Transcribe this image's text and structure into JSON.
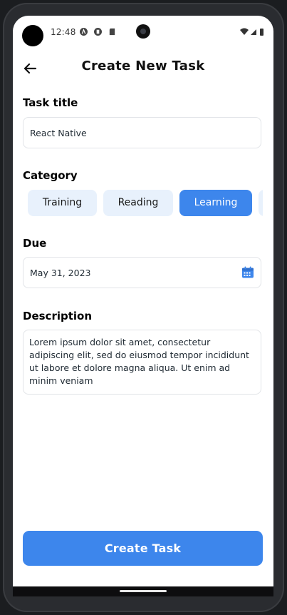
{
  "status_bar": {
    "time": "12:48"
  },
  "header": {
    "title": "Create New Task"
  },
  "task_title": {
    "label": "Task title",
    "value": "React Native"
  },
  "category": {
    "label": "Category",
    "chips": [
      {
        "label": "Training",
        "active": false
      },
      {
        "label": "Reading",
        "active": false
      },
      {
        "label": "Learning",
        "active": true
      },
      {
        "label": "",
        "active": false
      }
    ]
  },
  "due": {
    "label": "Due",
    "value": "May 31, 2023"
  },
  "description": {
    "label": "Description",
    "value": "Lorem ipsum dolor sit amet, consectetur adipiscing elit, sed do eiusmod tempor incididunt ut labore et dolore magna aliqua. Ut enim ad minim veniam"
  },
  "actions": {
    "create_label": "Create Task"
  },
  "colors": {
    "accent": "#3d86ec",
    "chip_bg": "#e8f1fc"
  }
}
